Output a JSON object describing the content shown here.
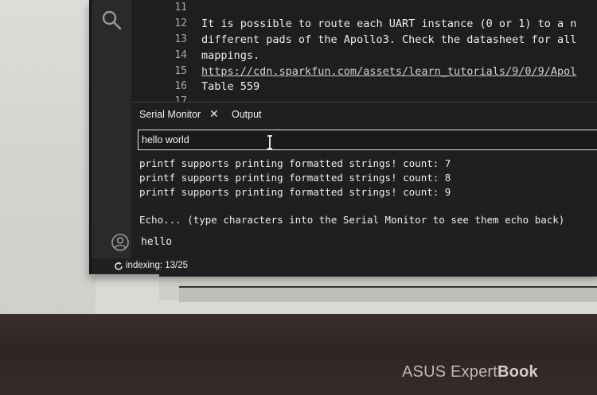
{
  "editor": {
    "lines": [
      {
        "num": "11",
        "text": ""
      },
      {
        "num": "12",
        "text": "It is possible to route each UART instance (0 or 1) to a n"
      },
      {
        "num": "13",
        "text": "different pads of the Apollo3. Check the datasheet for all"
      },
      {
        "num": "14",
        "text": "mappings."
      },
      {
        "num": "15",
        "text": "https://cdn.sparkfun.com/assets/learn_tutorials/9/0/9/Apol"
      },
      {
        "num": "16",
        "text": "Table 559"
      },
      {
        "num": "17",
        "text": ""
      }
    ]
  },
  "panel": {
    "tabs": [
      {
        "label": "Serial Monitor",
        "active": true
      },
      {
        "label": "Output",
        "active": false
      }
    ],
    "input_value": "hello world",
    "output_lines": [
      "printf supports printing formatted strings! count: 7",
      "printf supports printing formatted strings! count: 8",
      "printf supports printing formatted strings! count: 9",
      "",
      "Echo... (type characters into the Serial Monitor to see them echo back)"
    ],
    "echo_text": "hello"
  },
  "status": {
    "indexing": "indexing: 13/25"
  },
  "device": {
    "brand_prefix": "ASUS Expert",
    "brand_suffix": "Book"
  },
  "icons": {
    "activity_search": "search-icon",
    "tab_close": "close-icon",
    "account": "account-icon",
    "status_sync": "sync-icon",
    "text_cursor": "ibeam-cursor-icon"
  }
}
